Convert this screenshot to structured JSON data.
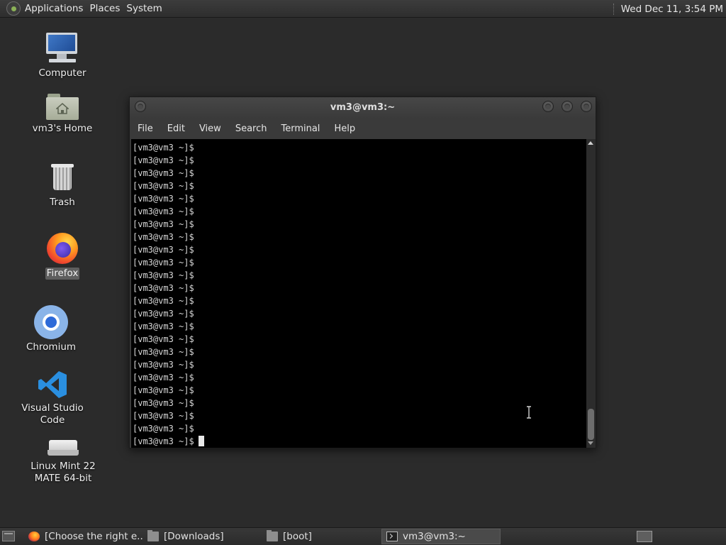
{
  "top_panel": {
    "menus": [
      "Applications",
      "Places",
      "System"
    ],
    "clock": "Wed Dec 11,  3:54 PM"
  },
  "desktop": {
    "icons": [
      {
        "label": "Computer",
        "icon": "computer-icon"
      },
      {
        "label": "vm3's Home",
        "icon": "home-folder-icon"
      },
      {
        "label": "Trash",
        "icon": "trash-icon"
      },
      {
        "label": "Firefox",
        "icon": "firefox-icon",
        "selected": true
      },
      {
        "label": "Chromium",
        "icon": "chromium-icon"
      },
      {
        "label": "Visual Studio Code",
        "icon": "vscode-icon"
      },
      {
        "label": "Linux Mint 22 MATE 64-bit",
        "icon": "drive-icon"
      }
    ]
  },
  "terminal": {
    "title": "vm3@vm3:~",
    "menu": [
      "File",
      "Edit",
      "View",
      "Search",
      "Terminal",
      "Help"
    ],
    "prompt": "[vm3@vm3 ~]$",
    "line_count": 24
  },
  "taskbar": {
    "tasks": [
      {
        "label": "[Choose the right e...",
        "icon": "firefox-icon"
      },
      {
        "label": "[Downloads]",
        "icon": "folder-icon"
      },
      {
        "label": "[boot]",
        "icon": "folder-icon"
      },
      {
        "label": "vm3@vm3:~",
        "icon": "terminal-icon",
        "active": true
      }
    ]
  }
}
